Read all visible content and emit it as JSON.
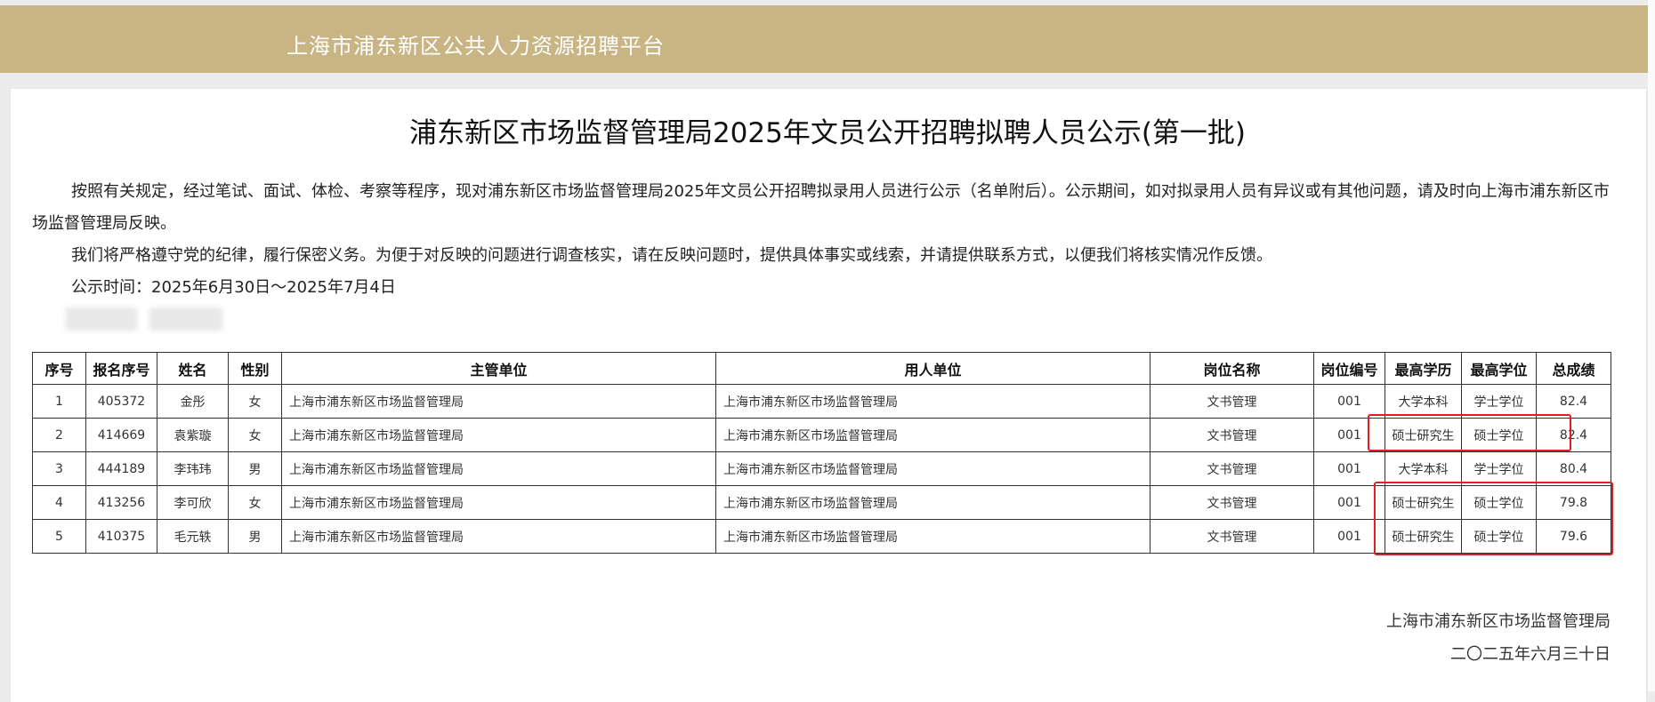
{
  "site": {
    "title": "上海市浦东新区公共人力资源招聘平台"
  },
  "notice": {
    "title": "浦东新区市场监督管理局2025年文员公开招聘拟聘人员公示(第一批)",
    "paragraph1": "按照有关规定，经过笔试、面试、体检、考察等程序，现对浦东新区市场监督管理局2025年文员公开招聘拟录用人员进行公示（名单附后）。公示期间，如对拟录用人员有异议或有其他问题，请及时向上海市浦东新区市场监督管理局反映。",
    "paragraph2": "我们将严格遵守党的纪律，履行保密义务。为便于对反映的问题进行调查核实，请在反映问题时，提供具体事实或线索，并请提供联系方式，以便我们将核实情况作反馈。",
    "period": "公示时间：2025年6月30日～2025年7月4日"
  },
  "table": {
    "headers": [
      "序号",
      "报名序号",
      "姓名",
      "性别",
      "主管单位",
      "用人单位",
      "岗位名称",
      "岗位编号",
      "最高学历",
      "最高学位",
      "总成绩"
    ],
    "rows": [
      [
        "1",
        "405372",
        "金彤",
        "女",
        "上海市浦东新区市场监督管理局",
        "上海市浦东新区市场监督管理局",
        "文书管理",
        "001",
        "大学本科",
        "学士学位",
        "82.4"
      ],
      [
        "2",
        "414669",
        "袁紫璇",
        "女",
        "上海市浦东新区市场监督管理局",
        "上海市浦东新区市场监督管理局",
        "文书管理",
        "001",
        "硕士研究生",
        "硕士学位",
        "82.4"
      ],
      [
        "3",
        "444189",
        "李玮玮",
        "男",
        "上海市浦东新区市场监督管理局",
        "上海市浦东新区市场监督管理局",
        "文书管理",
        "001",
        "大学本科",
        "学士学位",
        "80.4"
      ],
      [
        "4",
        "413256",
        "李可欣",
        "女",
        "上海市浦东新区市场监督管理局",
        "上海市浦东新区市场监督管理局",
        "文书管理",
        "001",
        "硕士研究生",
        "硕士学位",
        "79.8"
      ],
      [
        "5",
        "410375",
        "毛元轶",
        "男",
        "上海市浦东新区市场监督管理局",
        "上海市浦东新区市场监督管理局",
        "文书管理",
        "001",
        "硕士研究生",
        "硕士学位",
        "79.6"
      ]
    ]
  },
  "signature": {
    "org": "上海市浦东新区市场监督管理局",
    "date": "二〇二五年六月三十日"
  },
  "colors": {
    "header_bg": "#c9b584",
    "annotation": "#e02020"
  }
}
